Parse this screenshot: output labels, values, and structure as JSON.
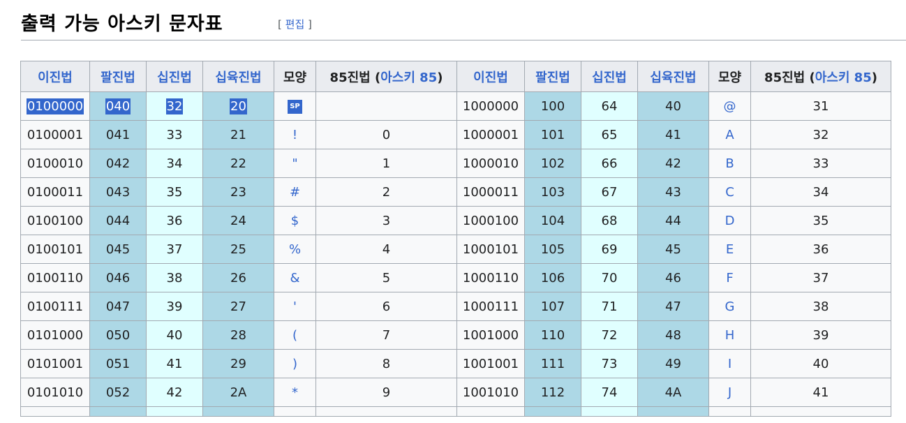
{
  "heading": {
    "title": "출력 가능 아스키 문자표",
    "edit_open": "[",
    "edit_label": "편집",
    "edit_close": "]"
  },
  "table": {
    "headers": [
      "이진법",
      "팔진법",
      "십진법",
      "십육진법",
      "모양",
      "85진법 (",
      "아스키 85",
      ")"
    ],
    "rows": [
      [
        "0100000",
        "040",
        "32",
        "20",
        "SP",
        "",
        "1000000",
        "100",
        "64",
        "40",
        "@",
        "31"
      ],
      [
        "0100001",
        "041",
        "33",
        "21",
        "!",
        "0",
        "1000001",
        "101",
        "65",
        "41",
        "A",
        "32"
      ],
      [
        "0100010",
        "042",
        "34",
        "22",
        "\"",
        "1",
        "1000010",
        "102",
        "66",
        "42",
        "B",
        "33"
      ],
      [
        "0100011",
        "043",
        "35",
        "23",
        "#",
        "2",
        "1000011",
        "103",
        "67",
        "43",
        "C",
        "34"
      ],
      [
        "0100100",
        "044",
        "36",
        "24",
        "$",
        "3",
        "1000100",
        "104",
        "68",
        "44",
        "D",
        "35"
      ],
      [
        "0100101",
        "045",
        "37",
        "25",
        "%",
        "4",
        "1000101",
        "105",
        "69",
        "45",
        "E",
        "36"
      ],
      [
        "0100110",
        "046",
        "38",
        "26",
        "&",
        "5",
        "1000110",
        "106",
        "70",
        "46",
        "F",
        "37"
      ],
      [
        "0100111",
        "047",
        "39",
        "27",
        "'",
        "6",
        "1000111",
        "107",
        "71",
        "47",
        "G",
        "38"
      ],
      [
        "0101000",
        "050",
        "40",
        "28",
        "(",
        "7",
        "1001000",
        "110",
        "72",
        "48",
        "H",
        "39"
      ],
      [
        "0101001",
        "051",
        "41",
        "29",
        ")",
        "8",
        "1001001",
        "111",
        "73",
        "49",
        "I",
        "40"
      ],
      [
        "0101010",
        "052",
        "42",
        "2A",
        "*",
        "9",
        "1001010",
        "112",
        "74",
        "4A",
        "J",
        "41"
      ]
    ]
  }
}
